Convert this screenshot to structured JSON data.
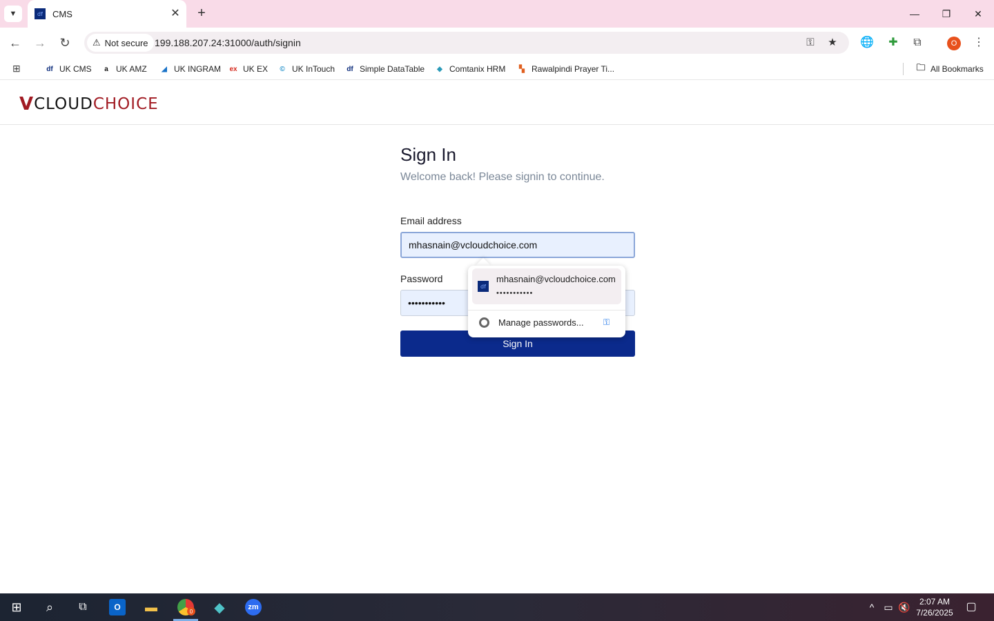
{
  "browser": {
    "tab": {
      "title": "CMS",
      "favicon_text": "df"
    },
    "address": {
      "security_label": "Not secure",
      "url": "199.188.207.24:31000/auth/signin"
    },
    "profile_initial": "O",
    "bookmarks": [
      {
        "label": "UK CMS",
        "icon": "df",
        "color": "#0a2a7a"
      },
      {
        "label": "UK AMZ",
        "icon": "a",
        "color": "#111111"
      },
      {
        "label": "UK INGRAM",
        "icon": "◢",
        "color": "#1a73c8"
      },
      {
        "label": "UK EX",
        "icon": "ex",
        "color": "#d62b1f"
      },
      {
        "label": "UK InTouch",
        "icon": "©",
        "color": "#1a8cc8"
      },
      {
        "label": "Simple DataTable",
        "icon": "df",
        "color": "#0a2a7a"
      },
      {
        "label": "Comtanix HRM",
        "icon": "◆",
        "color": "#2a9ab8"
      },
      {
        "label": "Rawalpindi Prayer Ti...",
        "icon": "▚",
        "color": "#e06020"
      }
    ],
    "all_bookmarks": "All Bookmarks"
  },
  "app": {
    "logo": {
      "v": "V",
      "part1": "CLOUD",
      "part2": "CHOICE"
    },
    "signin": {
      "title": "Sign In",
      "subtitle": "Welcome back! Please signin to continue.",
      "email_label": "Email address",
      "email_value": "mhasnain@vcloudchoice.com",
      "password_label": "Password",
      "password_value": "•••••••••••",
      "button": "Sign In"
    }
  },
  "autofill": {
    "username": "mhasnain@vcloudchoice.com",
    "password_mask": "•••••••••••",
    "manage": "Manage passwords..."
  },
  "taskbar": {
    "time": "2:07 AM",
    "date": "7/26/2025",
    "zoom_label": "zm",
    "chrome_badge": "0"
  }
}
